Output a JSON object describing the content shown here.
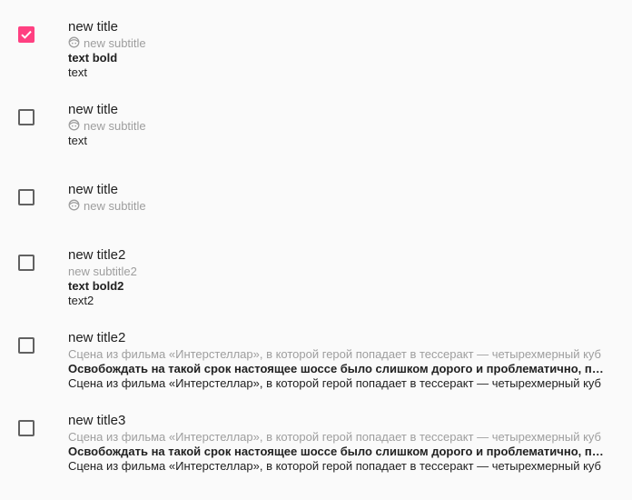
{
  "colors": {
    "accent": "#ff4081",
    "checkbox_border": "#616161",
    "title": "#212121",
    "subtitle": "#9e9e9e",
    "background": "#fafafa"
  },
  "items": [
    {
      "checked": true,
      "title": "new title",
      "subtitle_icon": "face-icon",
      "subtitle": "new subtitle",
      "bold": "text bold",
      "text": "text"
    },
    {
      "checked": false,
      "title": "new title",
      "subtitle_icon": "face-icon",
      "subtitle": "new subtitle",
      "text": "text"
    },
    {
      "checked": false,
      "title": "new title",
      "subtitle_icon": "face-icon",
      "subtitle": "new subtitle"
    },
    {
      "checked": false,
      "title": "new title2",
      "subtitle": "new subtitle2",
      "bold": "text bold2",
      "text": "text2"
    },
    {
      "checked": false,
      "title": "new title2",
      "subtitle": "Сцена из фильма «Интерстеллар», в которой герой попадает в тессеракт — четырехмерный куб",
      "bold": "Освобождать на такой срок настоящее шоссе было слишком дорого и проблематично, поэтому",
      "text": "Сцена из фильма «Интерстеллар», в которой герой попадает в тессеракт — четырехмерный куб"
    },
    {
      "checked": false,
      "title": "new title3",
      "subtitle": "Сцена из фильма «Интерстеллар», в которой герой попадает в тессеракт — четырехмерный куб",
      "bold": "Освобождать на такой срок настоящее шоссе было слишком дорого и проблематично, поэтому",
      "text": "Сцена из фильма «Интерстеллар», в которой герой попадает в тессеракт — четырехмерный куб"
    }
  ]
}
